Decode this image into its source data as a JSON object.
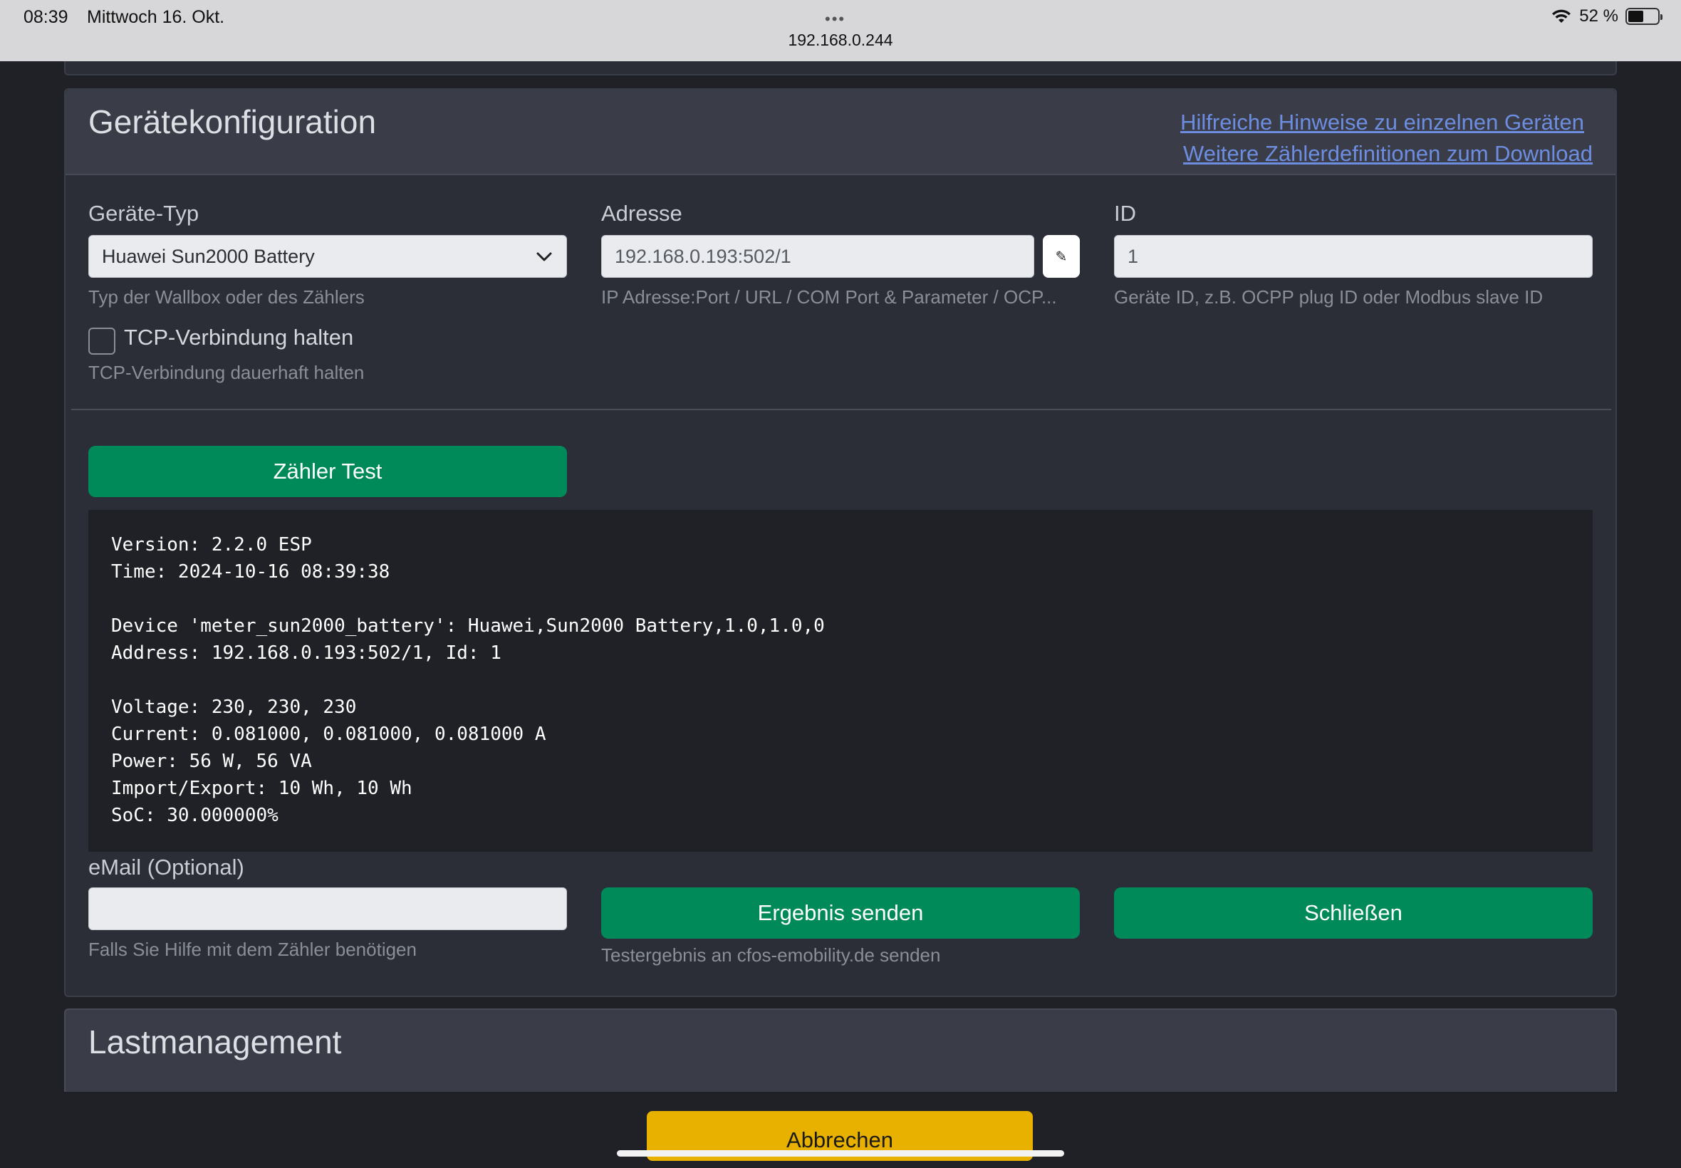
{
  "statusbar": {
    "time": "08:39",
    "date": "Mittwoch 16. Okt.",
    "dots": "•••",
    "url": "192.168.0.244",
    "battery_percent": "52 %",
    "battery_level": 0.52
  },
  "device_config": {
    "title": "Gerätekonfiguration",
    "link_hints": "Hilfreiche Hinweise zu einzelnen Geräten",
    "link_download": "Weitere Zählerdefinitionen zum Download",
    "device_type": {
      "label": "Geräte-Typ",
      "value": "Huawei Sun2000 Battery",
      "hint": "Typ der Wallbox oder des Zählers"
    },
    "address": {
      "label": "Adresse",
      "value": "192.168.0.193:502/1",
      "hint": "IP Adresse:Port / URL / COM Port & Parameter / OCP...",
      "edit_icon": "✎"
    },
    "id": {
      "label": "ID",
      "value": "1",
      "hint": "Geräte ID, z.B. OCPP plug ID oder Modbus slave ID"
    },
    "tcp": {
      "label": "TCP-Verbindung halten",
      "hint": "TCP-Verbindung dauerhaft halten",
      "checked": false
    },
    "test_button": "Zähler Test",
    "console_output": "Version: 2.2.0 ESP\nTime: 2024-10-16 08:39:38\n\nDevice 'meter_sun2000_battery': Huawei,Sun2000 Battery,1.0,1.0,0\nAddress: 192.168.0.193:502/1, Id: 1\n\nVoltage: 230, 230, 230\nCurrent: 0.081000, 0.081000, 0.081000 A\nPower: 56 W, 56 VA\nImport/Export: 10 Wh, 10 Wh\nSoC: 30.000000%",
    "email": {
      "label": "eMail (Optional)",
      "value": "",
      "hint": "Falls Sie Hilfe mit dem Zähler benötigen"
    },
    "send_button": "Ergebnis senden",
    "send_hint": "Testergebnis an cfos-emobility.de senden",
    "close_button": "Schließen"
  },
  "load_management": {
    "title": "Lastmanagement"
  },
  "cancel_button": "Abbrechen",
  "colors": {
    "background": "#1f2126",
    "card": "#2b2e37",
    "green": "#008a5a",
    "yellow": "#e8b100",
    "link": "#6d8de0"
  }
}
